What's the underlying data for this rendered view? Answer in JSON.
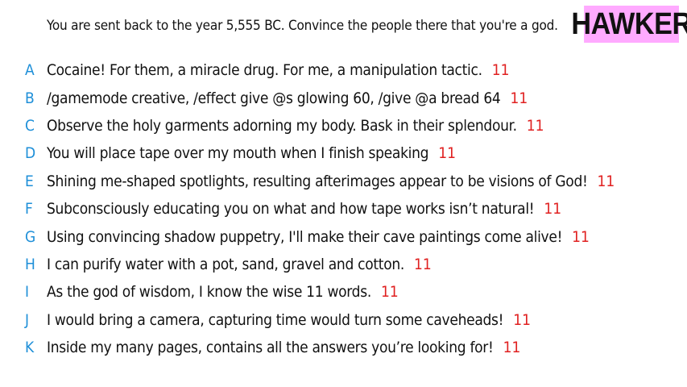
{
  "prompt": "You are sent back to the year 5,555 BC. Convince the people there that you're a god.",
  "brand": {
    "name": "HAWKER",
    "background": "#ffaaff"
  },
  "colors": {
    "letter": "#1e8fd8",
    "score": "#e02020",
    "text": "#111111"
  },
  "answers": [
    {
      "letter": "A",
      "text": "Cocaine! For them, a miracle drug. For me, a manipulation tactic.",
      "score": "11"
    },
    {
      "letter": "B",
      "text": "/gamemode creative, /effect give @s glowing 60, /give @a bread 64",
      "score": "11"
    },
    {
      "letter": "C",
      "text": "Observe the holy garments adorning my body. Bask in their splendour.",
      "score": "11"
    },
    {
      "letter": "D",
      "text": "You will place tape over my mouth when I finish speaking",
      "score": "11"
    },
    {
      "letter": "E",
      "text": "Shining me-shaped spotlights, resulting afterimages appear to be visions of God!",
      "score": "11"
    },
    {
      "letter": "F",
      "text": "Subconsciously educating you on what and how tape works isn’t natural!",
      "score": "11"
    },
    {
      "letter": "G",
      "text": "Using convincing shadow puppetry, I'll make their cave paintings come alive!",
      "score": "11"
    },
    {
      "letter": "H",
      "text": "I can purify water with a pot, sand, gravel and cotton.",
      "score": "11"
    },
    {
      "letter": "I",
      "text": "As the god of wisdom, I know the wise 11 words.",
      "score": "11"
    },
    {
      "letter": "J",
      "text": "I would bring a camera, capturing time would turn some caveheads!",
      "score": "11"
    },
    {
      "letter": "K",
      "text": "Inside my many pages, contains all the answers you’re looking for!",
      "score": "11"
    }
  ]
}
